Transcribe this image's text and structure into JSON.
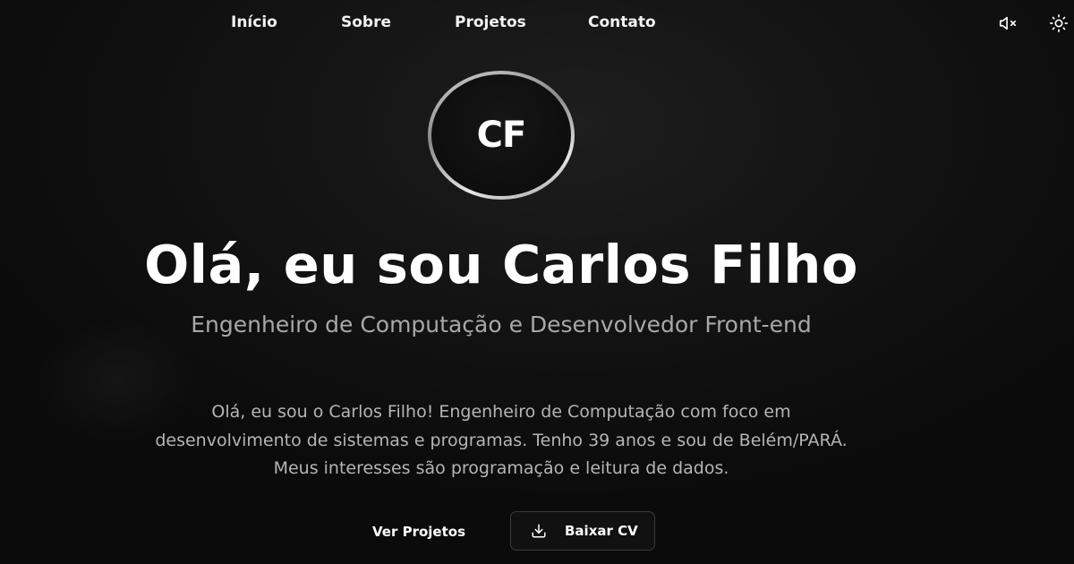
{
  "nav": {
    "links": [
      {
        "label": "Início"
      },
      {
        "label": "Sobre"
      },
      {
        "label": "Projetos"
      },
      {
        "label": "Contato"
      }
    ],
    "icons": {
      "mute": "speaker-muted-icon",
      "theme": "sun-icon"
    }
  },
  "avatar": {
    "initials": "CF"
  },
  "hero": {
    "title": "Olá, eu sou Carlos Filho",
    "subtitle": "Engenheiro de Computação e Desenvolvedor Front-end",
    "bio_lines": [
      "Olá, eu sou o Carlos Filho! Engenheiro de Computação com foco em",
      "desenvolvimento de sistemas e programas. Tenho 39 anos e sou de Belém/PARÁ.",
      "Meus interesses são programação e leitura de dados."
    ]
  },
  "actions": {
    "projects_label": "Ver Projetos",
    "cv_label": "Baixar CV",
    "cv_icon": "download-icon"
  },
  "colors": {
    "background": "#0d0d0d",
    "text": "#ffffff",
    "muted_text": "#a8a8a8",
    "button_border": "#3a3a3a"
  }
}
